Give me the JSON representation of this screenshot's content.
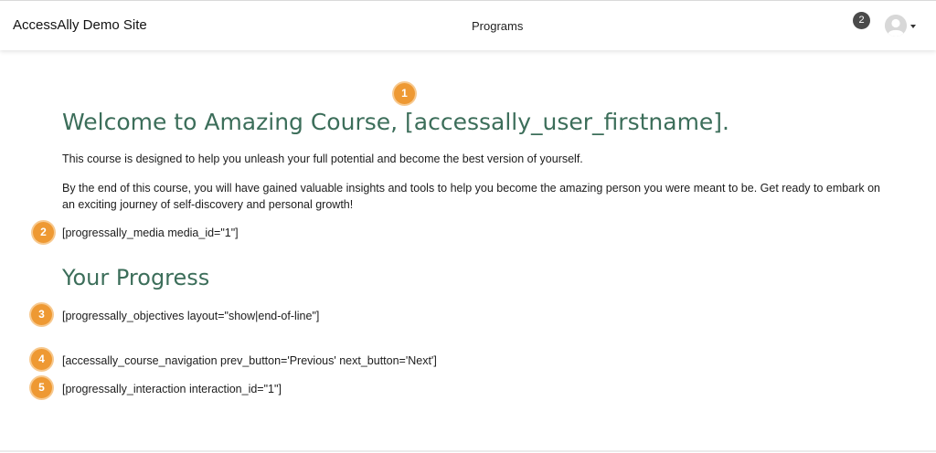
{
  "header": {
    "site_title": "AccessAlly Demo Site",
    "nav_programs": "Programs",
    "notification_count": "2"
  },
  "markers": [
    "1",
    "2",
    "3",
    "4",
    "5"
  ],
  "content": {
    "welcome_heading": "Welcome to Amazing Course, [accessally_user_firstname].",
    "intro_paragraph": "This course is designed to help you unleash your full potential and become the best version of yourself.",
    "outcome_paragraph": "By the end of this course, you will have gained valuable insights and tools to help you become the amazing person you were meant to be. Get ready to embark on an exciting journey of self-discovery and personal growth!",
    "media_shortcode": "[progressally_media media_id=\"1\"]",
    "progress_heading": "Your Progress",
    "objectives_shortcode": "[progressally_objectives layout=\"show|end-of-line\"]",
    "navigation_shortcode": "[accessally_course_navigation prev_button='Previous' next_button='Next']",
    "interaction_shortcode": "[progressally_interaction interaction_id=\"1\"]"
  },
  "colors": {
    "heading": "#3c6e5a",
    "marker": "#ee9933",
    "badge": "#4a4a4a"
  },
  "icons": {
    "avatar": "user-avatar-icon",
    "caret": "caret-down-icon"
  }
}
